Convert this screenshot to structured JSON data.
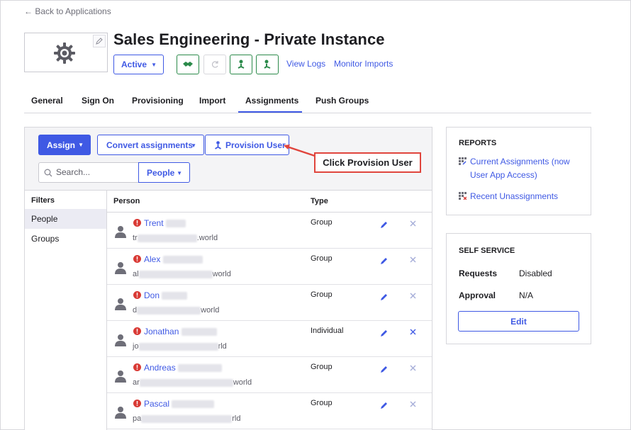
{
  "nav": {
    "back_label": "← Back to Applications"
  },
  "app": {
    "title": "Sales Engineering - Private Instance",
    "status": "Active",
    "links": {
      "view_logs": "View Logs",
      "monitor_imports": "Monitor Imports"
    }
  },
  "tabs": [
    {
      "label": "General"
    },
    {
      "label": "Sign On"
    },
    {
      "label": "Provisioning"
    },
    {
      "label": "Import"
    },
    {
      "label": "Assignments",
      "active": true
    },
    {
      "label": "Push Groups"
    }
  ],
  "toolbar": {
    "assign_label": "Assign",
    "convert_label": "Convert assignments",
    "provision_label": "Provision User"
  },
  "search": {
    "placeholder": "Search...",
    "scope": "People"
  },
  "callout": {
    "text": "Click Provision User",
    "color": "#e0453d"
  },
  "filters": {
    "header": "Filters",
    "items": [
      {
        "label": "People",
        "selected": true
      },
      {
        "label": "Groups"
      }
    ]
  },
  "table": {
    "headers": {
      "person": "Person",
      "type": "Type"
    },
    "rows": [
      {
        "name": "Trent",
        "email_prefix": "tr",
        "email_suffix": ".world",
        "type": "Group"
      },
      {
        "name": "Alex",
        "email_prefix": "al",
        "email_suffix": "world",
        "type": "Group"
      },
      {
        "name": "Don",
        "email_prefix": "d",
        "email_suffix": "world",
        "type": "Group"
      },
      {
        "name": "Jonathan",
        "email_prefix": "jo",
        "email_suffix": "rld",
        "type": "Individual"
      },
      {
        "name": "Andreas",
        "email_prefix": "ar",
        "email_suffix": "world",
        "type": "Group"
      },
      {
        "name": "Pascal",
        "email_prefix": "pa",
        "email_suffix": "rld",
        "type": "Group"
      }
    ]
  },
  "reports": {
    "header": "REPORTS",
    "items": [
      {
        "label": "Current Assignments (now User App Access)"
      },
      {
        "label": "Recent Unassignments"
      }
    ]
  },
  "self_service": {
    "header": "SELF SERVICE",
    "requests_label": "Requests",
    "requests_value": "Disabled",
    "approval_label": "Approval",
    "approval_value": "N/A",
    "edit_label": "Edit"
  },
  "colors": {
    "accent": "#3f59e4",
    "success": "#2b8a4a",
    "warning": "#d93a35"
  }
}
